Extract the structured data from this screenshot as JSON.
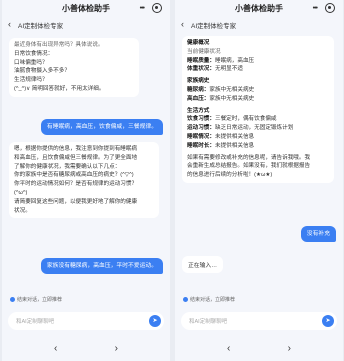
{
  "app_title": "小善体检助手",
  "chat_title": "AI定制体检专家",
  "menu_glyph": "•••",
  "back_glyph": "‹",
  "left": {
    "bot1_lines": [
      "最近身体有出现异常吗？具体说说。",
      "日常饮食情况：",
      "口味偏重吗？",
      "油腻食物摄入多不多？",
      "生活规律吗？",
      "(^_^)∨ 简明回答就好，不用太详细。"
    ],
    "user1": "有睡眠病，高血压，饮食偏咸，三餐规律。",
    "bot2_lines": [
      "嗯，根据你提供的信息，我注意到你提到有睡眠病",
      "和高血压，且饮食偏咸但三餐规律。为了更全面地",
      "了解你的健康状况，我需要确认以下几点：",
      "你的家族中是否有糖尿病或高血压的病史？(^▽^)",
      "你平时的运动情况如何？是否有规律的运动习惯？",
      "(^ω^)",
      "请简要回复这些问题，以便我更好地了解你的健康",
      "状况。"
    ],
    "user2": "家族没有糖尿病，高血压，平时不爱运动。",
    "hint_text": "结束对话，立即推荐",
    "input_placeholder": "和AI定制聊聊吧",
    "nav_prev": "‹",
    "nav_next": "›"
  },
  "right": {
    "summary": [
      {
        "text": "健康概况",
        "style": "hd"
      },
      {
        "text": "当前健康状况",
        "style": "dim"
      },
      {
        "key": "睡眠质量：",
        "text": "睡眠病，高血压"
      },
      {
        "key": "体重状况：",
        "text": "无明显不适"
      },
      {
        "text": "",
        "style": "gap"
      },
      {
        "text": "家族病史",
        "style": "hd"
      },
      {
        "key": "糖尿病：",
        "text": "家族中无相关病史"
      },
      {
        "key": "高血压：",
        "text": "家族中无相关病史"
      },
      {
        "text": "",
        "style": "gap"
      },
      {
        "text": "生活方式",
        "style": "hd"
      },
      {
        "key": "饮食习惯：",
        "text": "三餐定时，偶有饮食偏咸"
      },
      {
        "key": "运动习惯：",
        "text": "缺乏日常运动，无固定锻炼计划"
      },
      {
        "key": "睡眠情况：",
        "text": "未提供相关信息"
      },
      {
        "key": "睡眠时长：",
        "text": "未提供相关信息"
      },
      {
        "text": "",
        "style": "gap"
      },
      {
        "text": "如果有需要修改或补充的信息呢，请告诉我哦。我",
        "style": "plain"
      },
      {
        "text": "会重新生成总结报告。如果没有，我们就根据报告",
        "style": "plain"
      },
      {
        "text": "的信息进行后续的分析啦！(★ω★)",
        "style": "plain"
      }
    ],
    "user_reply": "没有补充",
    "typing": "正在输入…",
    "hint_text": "结束对话，立即推荐",
    "input_placeholder": "和AI定制聊聊吧",
    "nav_prev": "‹",
    "nav_next": "›"
  }
}
